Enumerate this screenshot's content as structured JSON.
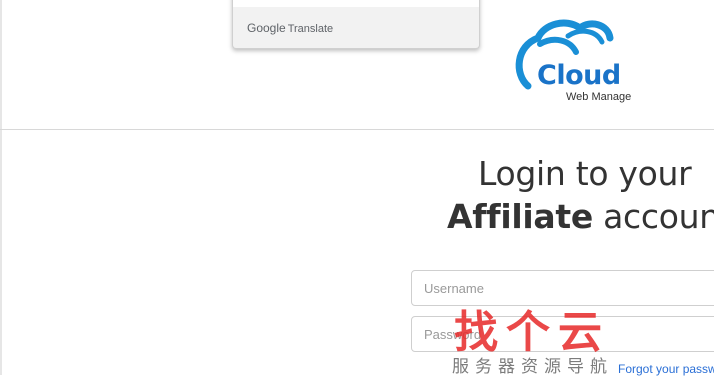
{
  "translate_popup": {
    "brand_google": "Google",
    "brand_translate": "Translate"
  },
  "logo": {
    "word": "Cloud",
    "sub": "Web Manage",
    "color": "#1a73c8"
  },
  "login": {
    "title_line1": "Login to your",
    "title_bold": "Affiliate",
    "title_rest": " account",
    "username_placeholder": "Username",
    "password_placeholder": "Password",
    "forgot_label": "Forgot your password?"
  },
  "watermark": {
    "main": "找个云",
    "sub": "服务器资源导航",
    "color": "#e62828"
  }
}
